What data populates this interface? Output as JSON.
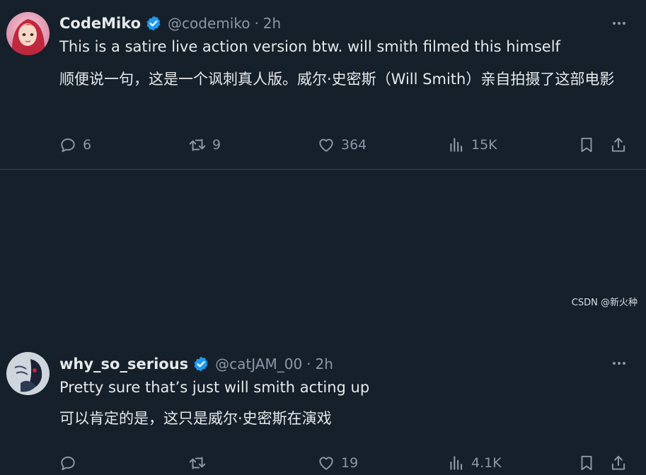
{
  "tweets": [
    {
      "display_name": "CodeMiko",
      "handle": "@codemiko",
      "separator": "·",
      "time": "2h",
      "text_en": "This is a satire live action version btw. will smith filmed this himself",
      "text_zh": "顺便说一句，这是一个讽刺真人版。威尔·史密斯（Will Smith）亲自拍摄了这部电影",
      "replies": "6",
      "retweets": "9",
      "likes": "364",
      "views": "15K"
    },
    {
      "display_name": "why_so_serious",
      "handle": "@catJAM_00",
      "separator": "·",
      "time": "2h",
      "text_en": "Pretty sure that’s just will smith acting up",
      "text_zh": "可以肯定的是，这只是威尔·史密斯在演戏",
      "replies": "",
      "retweets": "",
      "likes": "19",
      "views": "4.1K"
    }
  ],
  "icons": {
    "verified": "verified-badge-icon",
    "more": "more-options-icon",
    "reply": "reply-icon",
    "retweet": "retweet-icon",
    "like": "heart-icon",
    "views": "views-chart-icon",
    "bookmark": "bookmark-icon",
    "share": "share-icon"
  },
  "colors": {
    "background": "#15202b",
    "text": "#e7e9ea",
    "secondary": "#8b98a5",
    "verified": "#1d9bf0"
  },
  "watermark": "CSDN @新火种"
}
